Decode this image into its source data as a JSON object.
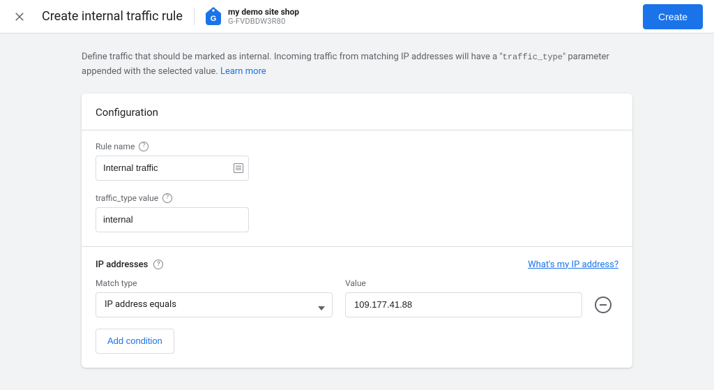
{
  "header": {
    "title": "Create internal traffic rule",
    "property_name": "my demo site shop",
    "property_id": "G-FVDBDW3R80",
    "create_button": "Create"
  },
  "intro": {
    "text_before_code": "Define traffic that should be marked as internal. Incoming traffic from matching IP addresses will have a \"",
    "code": "traffic_type",
    "text_after_code": "\" parameter appended with the selected value. ",
    "learn_more": "Learn more"
  },
  "card": {
    "header": "Configuration",
    "rule_name": {
      "label": "Rule name",
      "value": "Internal traffic"
    },
    "traffic_type": {
      "label": "traffic_type value",
      "value": "internal"
    },
    "ip": {
      "section_label": "IP addresses",
      "whats_my_ip": "What's my IP address?",
      "match_type_label": "Match type",
      "value_label": "Value",
      "match_type_selected": "IP address equals",
      "value": "109.177.41.88",
      "add_condition": "Add condition"
    }
  }
}
